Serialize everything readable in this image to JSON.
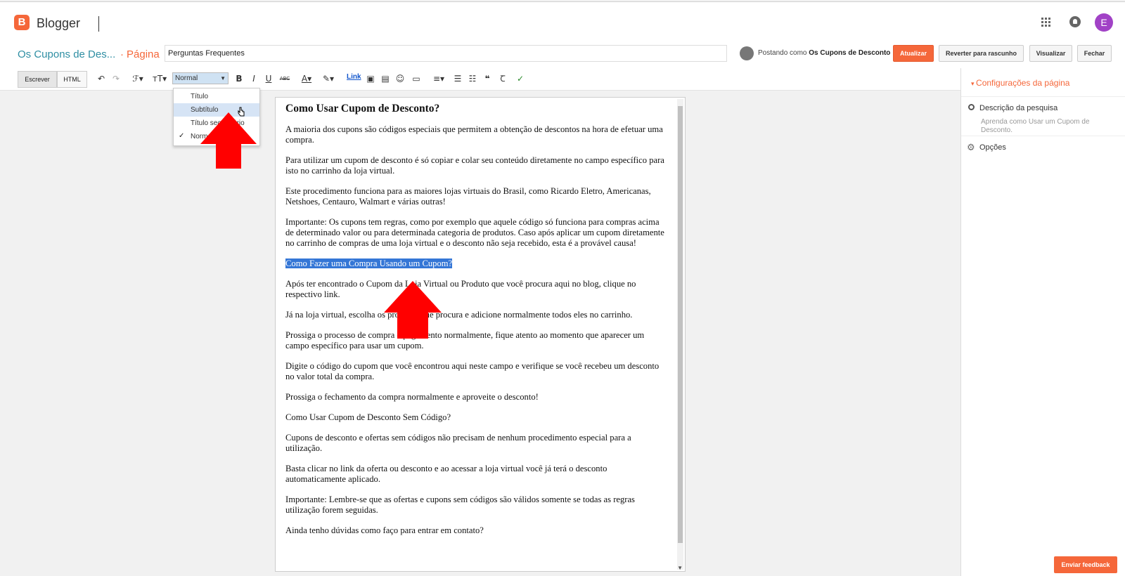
{
  "header": {
    "brand": "Blogger",
    "avatar_letter": "E"
  },
  "titlebar": {
    "blog_title": "Os Cupons de Des...",
    "separator": "·",
    "page_label": "Página",
    "page_title_value": "Perguntas Frequentes",
    "posting_as_prefix": "Postando como",
    "posting_as_name": "Os Cupons de Desconto",
    "buttons": {
      "update": "Atualizar",
      "revert": "Reverter para rascunho",
      "preview": "Visualizar",
      "close": "Fechar"
    }
  },
  "toolbar": {
    "mode_compose": "Escrever",
    "mode_html": "HTML",
    "format_value": "Normal",
    "link_label": "Link"
  },
  "format_dropdown": {
    "items": [
      "Título",
      "Subtítulo",
      "Título secundário",
      "Normal"
    ],
    "hovered": "Subtítulo",
    "selected": "Normal"
  },
  "editor": {
    "heading": "Como Usar Cupom de Desconto?",
    "paragraphs": [
      "A maioria dos cupons são códigos especiais que permitem a obtenção de descontos na hora de efetuar uma compra.",
      "Para utilizar um cupom de desconto é só copiar e colar seu conteúdo diretamente no campo específico para isto no carrinho da loja virtual.",
      "Este procedimento funciona para as maiores lojas virtuais do Brasil, como Ricardo Eletro, Americanas, Netshoes, Centauro, Walmart e várias outras!",
      "Importante: Os cupons tem regras, como por exemplo que aquele código só funciona para compras acima de determinado valor ou para determinada categoria de produtos. Caso após aplicar um cupom diretamente no carrinho de compras de uma loja virtual e o desconto não seja recebido, esta é a provável causa!",
      "Como Fazer uma Compra Usando um Cupom?",
      "Após ter encontrado o Cupom da Loja Virtual ou Produto que você procura aqui no blog, clique no respectivo link.",
      "Já na loja virtual, escolha os produtos que procura e adicione normalmente todos eles no carrinho.",
      "Prossiga o processo de compra  e pagamento normalmente, fique atento ao momento que aparecer um campo específico para usar um cupom.",
      "Digite o código do cupom que você encontrou aqui neste campo e verifique se você recebeu um desconto no valor total da compra.",
      "Prossiga o fechamento da compra normalmente e aproveite o desconto!",
      "Como Usar Cupom de Desconto Sem Código?",
      "Cupons de desconto e ofertas sem códigos não precisam de nenhum procedimento especial para a utilização.",
      "Basta clicar no link da oferta ou desconto e ao acessar a loja virtual você já terá o desconto automaticamente aplicado.",
      "Importante: Lembre-se que as ofertas e cupons sem códigos são válidos somente se todas as regras utilização forem seguidas.",
      "Ainda tenho dúvidas como faço para entrar em contato?"
    ],
    "selected_paragraph_index": 4
  },
  "right_panel": {
    "header": "Configurações da página",
    "search_description_label": "Descrição da pesquisa",
    "search_description_value": "Aprenda como Usar um Cupom de Desconto.",
    "options_label": "Opções"
  },
  "feedback_button": "Enviar feedback",
  "colors": {
    "accent": "#f5673a",
    "link": "#2e8ea3",
    "selection": "#3476d6",
    "annotation_arrow": "#ff0000"
  }
}
